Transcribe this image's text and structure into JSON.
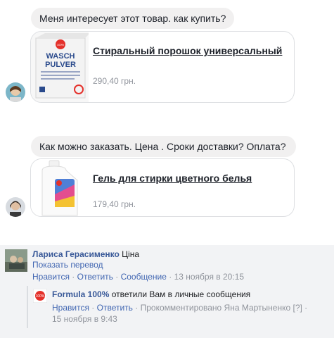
{
  "messages": [
    {
      "text": "Меня интересует этот товар. как купить?",
      "product": {
        "title": "Стиральный порошок универсальный",
        "price": "290,40 грн.",
        "image_label_top": "WASCH",
        "image_label_bottom": "PULVER",
        "badge": "100%"
      }
    },
    {
      "text": "Как можно заказать. Цена . Сроки доставки?  Оплата?",
      "product": {
        "title": "Гель для стирки цветного белья",
        "price": "179,40 грн."
      }
    }
  ],
  "comment": {
    "author": "Лариса Герасименко",
    "text": "Ціна",
    "see_translation": "Показать перевод",
    "actions": {
      "like": "Нравится",
      "reply": "Ответить",
      "message": "Сообщение"
    },
    "separator": " · ",
    "timestamp": "13 ноября в 20:15"
  },
  "reply": {
    "author": "Formula 100%",
    "text": "ответили Вам в личные сообщения",
    "logo_text": "100%",
    "actions": {
      "like": "Нравится",
      "reply": "Ответить"
    },
    "commented_by": "Прокомментировано Яна Мартыненко",
    "help": "[?]",
    "timestamp": "15 ноября в 9:43"
  },
  "colors": {
    "link": "#4267b2",
    "name": "#385898",
    "muted": "#90949c",
    "bubble": "#f1f0f0",
    "brand_red": "#e4312b"
  }
}
